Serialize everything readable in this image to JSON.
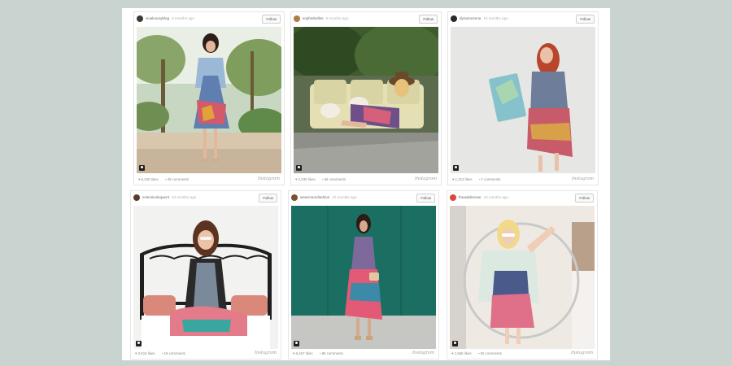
{
  "page": {
    "background": "#c9d3d0",
    "sheet": "#ffffff"
  },
  "cards": [
    {
      "username": "vivaluxuryblog",
      "time_ago": "9 months ago",
      "follow": "Follow",
      "likes": "5,340 likes",
      "comments": "49 comments",
      "brand": "Instagram",
      "avatar_color": "#3a3a3a"
    },
    {
      "username": "sophiebelles",
      "time_ago": "9 months ago",
      "follow": "Follow",
      "likes": "2,030 likes",
      "comments": "36 comments",
      "brand": "Instagram",
      "avatar_color": "#b07a4a"
    },
    {
      "username": "dynamozena",
      "time_ago": "10 months ago",
      "follow": "Follow",
      "likes": "1,313 likes",
      "comments": "7 comments",
      "brand": "Instagram",
      "avatar_color": "#2b2b2b"
    },
    {
      "username": "eclecticeloquent",
      "time_ago": "10 months ago",
      "follow": "Follow",
      "likes": "3,615 likes",
      "comments": "19 comments",
      "brand": "Instagram",
      "avatar_color": "#5a3a2a"
    },
    {
      "username": "wearmoonfashion",
      "time_ago": "10 months ago",
      "follow": "Follow",
      "likes": "6,457 likes",
      "comments": "86 comments",
      "brand": "Instagram",
      "avatar_color": "#7a5030"
    },
    {
      "username": "theadelierose",
      "time_ago": "10 months ago",
      "follow": "Follow",
      "likes": "1,566 likes",
      "comments": "52 comments",
      "brand": "Instagram",
      "avatar_color": "#d84a3a"
    }
  ]
}
